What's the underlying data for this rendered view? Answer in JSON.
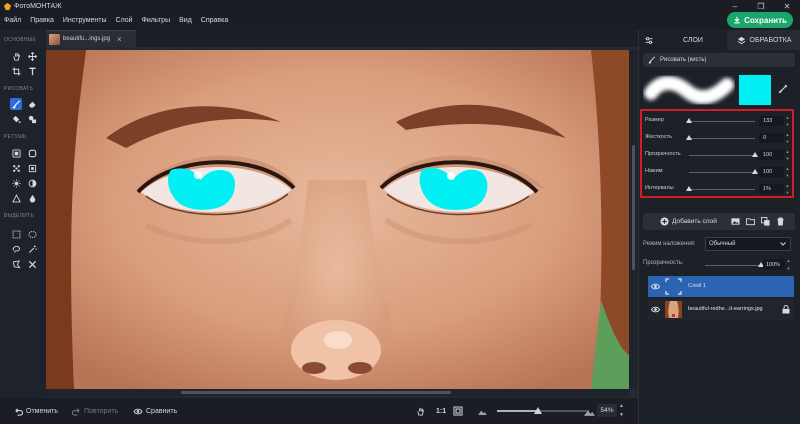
{
  "app": {
    "title": "ФотоМОНТАЖ",
    "menu": [
      "Файл",
      "Правка",
      "Инструменты",
      "Слой",
      "Фильтры",
      "Вид",
      "Справка"
    ],
    "save_label": "Сохранить"
  },
  "toolbar": {
    "sections": [
      "ОСНОВНЫЕ",
      "РИСОВАТЬ",
      "РЕТУШЬ",
      "ВЫДЕЛИТЬ"
    ],
    "tools": [
      {
        "icon": "hand-icon",
        "section": 0
      },
      {
        "icon": "move-icon",
        "section": 0
      },
      {
        "icon": "crop-icon",
        "section": 0
      },
      {
        "icon": "text-icon",
        "section": 0
      },
      {
        "icon": "brush-icon",
        "section": 1,
        "active": true
      },
      {
        "icon": "eraser-icon",
        "section": 1
      },
      {
        "icon": "fill-icon",
        "section": 1
      },
      {
        "icon": "shapes-icon",
        "section": 1
      },
      {
        "icon": "stamp-icon",
        "section": 2
      },
      {
        "icon": "patch-icon",
        "section": 2
      },
      {
        "icon": "blur-icon",
        "section": 2
      },
      {
        "icon": "sharpen-icon",
        "section": 2
      },
      {
        "icon": "brightness-icon",
        "section": 2
      },
      {
        "icon": "contrast-icon",
        "section": 2
      },
      {
        "icon": "triangle-icon",
        "section": 2
      },
      {
        "icon": "drop-icon",
        "section": 2
      },
      {
        "icon": "rect-select-icon",
        "section": 3
      },
      {
        "icon": "ellipse-select-icon",
        "section": 3
      },
      {
        "icon": "lasso-icon",
        "section": 3
      },
      {
        "icon": "magic-wand-icon",
        "section": 3
      },
      {
        "icon": "poly-lasso-icon",
        "section": 3
      },
      {
        "icon": "tools-icon",
        "section": 3
      }
    ]
  },
  "document_tab": {
    "name": "beautifu...ings.jpg"
  },
  "bottom": {
    "undo_label": "Отменить",
    "redo_label": "Повторить",
    "compare_label": "Сравнить",
    "actual_size": "1:1",
    "zoom_value": "54%",
    "zoom_fraction": 0.45
  },
  "panel": {
    "tab_layers": "СЛОИ",
    "tab_process": "ОБРАБОТКА",
    "tool_name": "Рисовать (кисть)",
    "brush_color": "#00f0f4",
    "settings": [
      {
        "label": "Размер",
        "value": "133",
        "fraction": 0.0
      },
      {
        "label": "Жесткость",
        "value": "0",
        "fraction": 0.0
      },
      {
        "label": "Прозрачность",
        "value": "100",
        "fraction": 1.0
      },
      {
        "label": "Нажим",
        "value": "100",
        "fraction": 1.0
      },
      {
        "label": "Интервалы",
        "value": "1%",
        "fraction": 0.0
      }
    ],
    "add_layer_label": "Добавить слой",
    "blend_label": "Режим наложения:",
    "blend_value": "Обычный",
    "opacity_label": "Прозрачность:",
    "opacity_value": "100%",
    "opacity_fraction": 1.0,
    "layers": [
      {
        "name": "Слой 1",
        "selected": true
      },
      {
        "name": "beautiful-redhe...it-earrings.jpg",
        "selected": false
      }
    ]
  }
}
